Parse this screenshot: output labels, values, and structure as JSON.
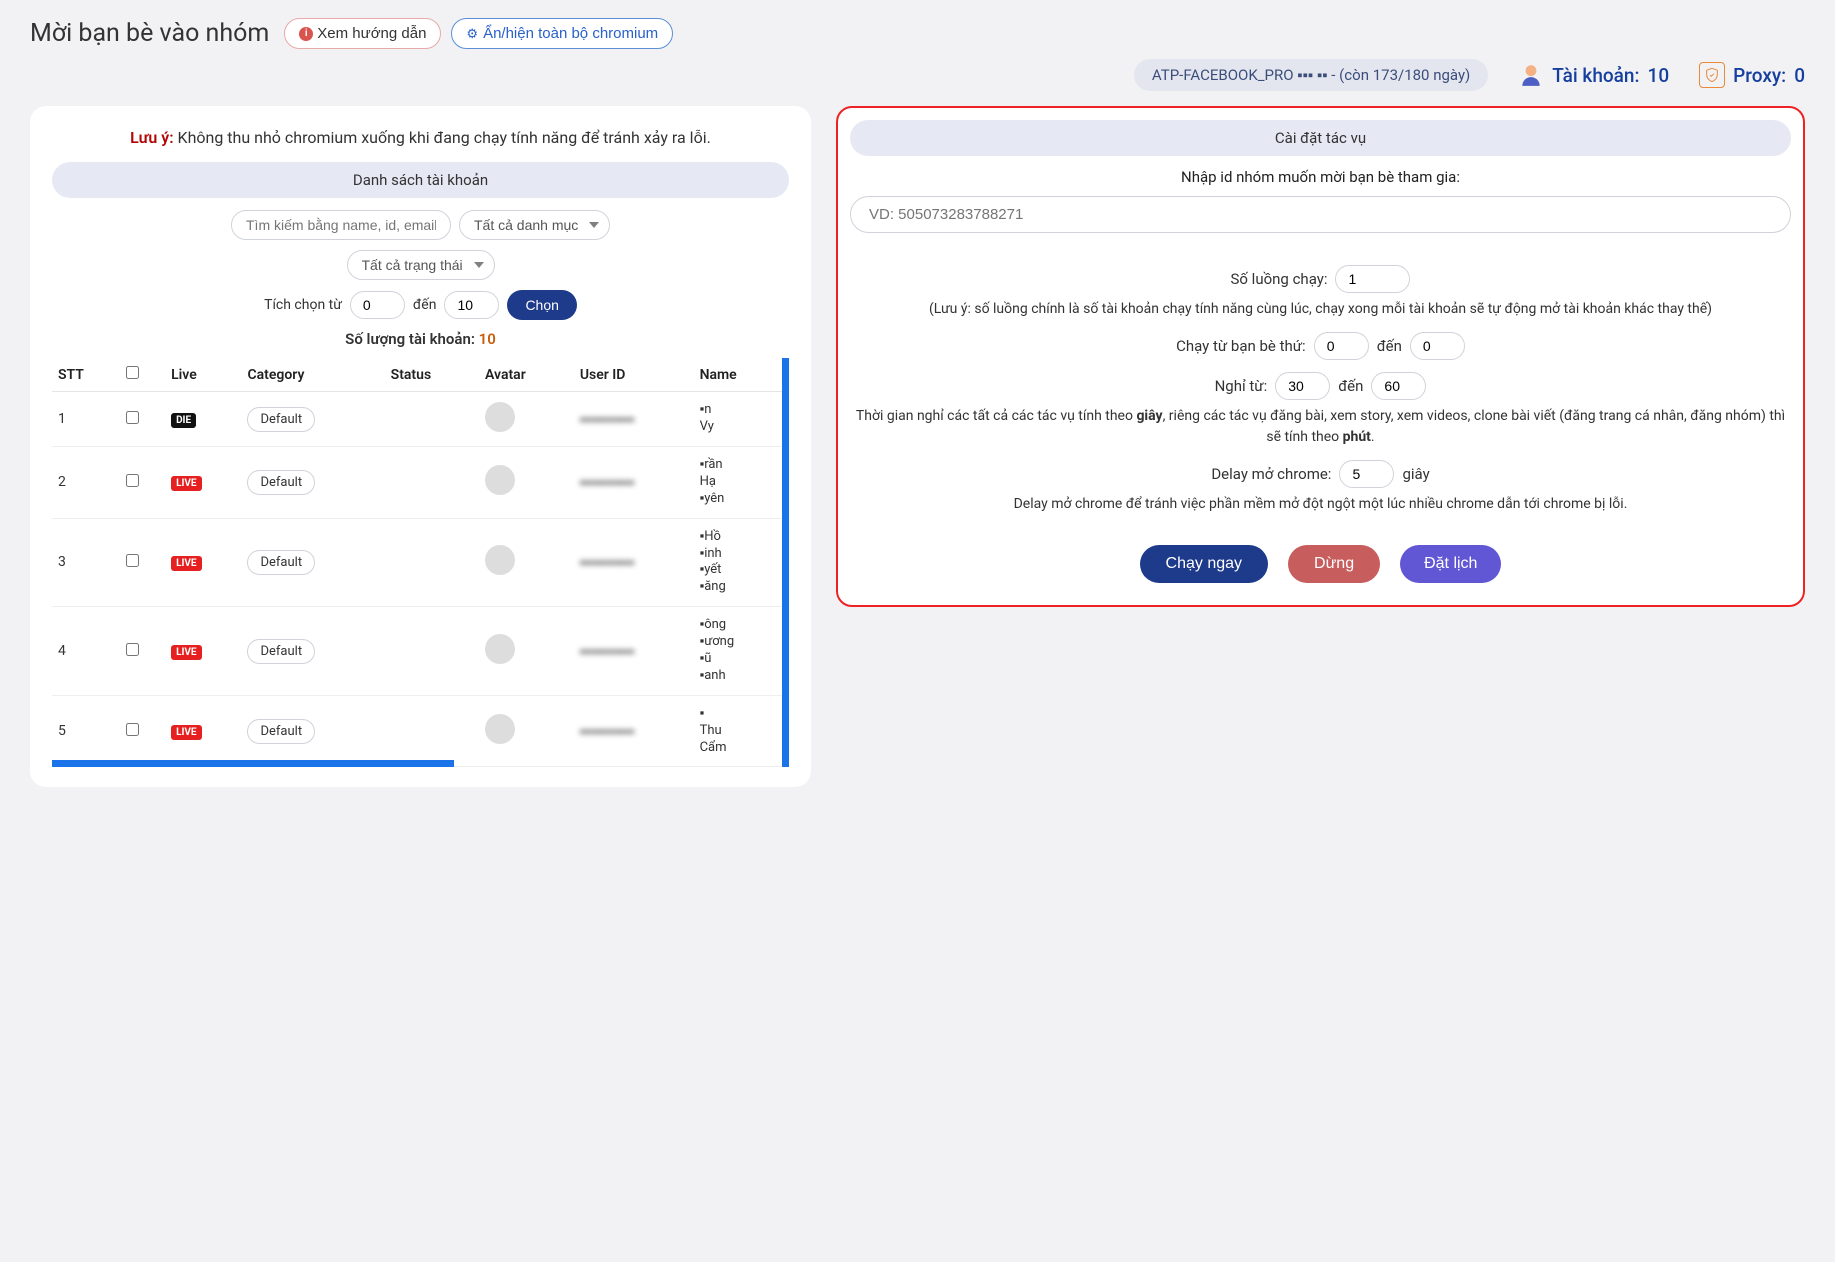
{
  "header": {
    "title": "Mời bạn bè vào nhóm",
    "guide_btn": "Xem hướng dẫn",
    "toggle_chromium_btn": "Ẩn/hiện toàn bộ chromium"
  },
  "info_bar": {
    "license": "ATP-FACEBOOK_PRO ▪▪▪ ▪▪ - (còn 173/180 ngày)",
    "accounts_label": "Tài khoản:",
    "accounts_count": "10",
    "proxy_label": "Proxy:",
    "proxy_count": "0"
  },
  "left_panel": {
    "warning_prefix": "Lưu ý:",
    "warning_text": "Không thu nhỏ chromium xuống khi đang chạy tính năng để tránh xảy ra lỗi.",
    "accounts_header": "Danh sách tài khoản",
    "search_placeholder": "Tìm kiếm bằng name, id, email",
    "category_select": "Tất cả danh mục",
    "status_select": "Tất cả trạng thái",
    "tick_label": "Tích chọn từ",
    "tick_from": "0",
    "tick_to_label": "đến",
    "tick_to": "10",
    "tick_btn": "Chọn",
    "count_label": "Số lượng tài khoản:",
    "count_value": "10",
    "columns": {
      "stt": "STT",
      "checkbox": "",
      "live": "Live",
      "category": "Category",
      "status": "Status",
      "avatar": "Avatar",
      "user_id": "User ID",
      "name": "Name"
    },
    "rows": [
      {
        "stt": "1",
        "live": "DIE",
        "category": "Default",
        "status": "",
        "user_id": "▪▪▪▪▪▪▪▪▪▪▪",
        "name": "▪n Vy"
      },
      {
        "stt": "2",
        "live": "LIVE",
        "category": "Default",
        "status": "",
        "user_id": "▪▪▪▪▪▪▪▪▪▪▪",
        "name": "▪rần Hạ ▪yên"
      },
      {
        "stt": "3",
        "live": "LIVE",
        "category": "Default",
        "status": "",
        "user_id": "▪▪▪▪▪▪▪▪▪▪▪",
        "name": "▪Hồ ▪inh ▪yết ▪ăng"
      },
      {
        "stt": "4",
        "live": "LIVE",
        "category": "Default",
        "status": "",
        "user_id": "▪▪▪▪▪▪▪▪▪▪▪",
        "name": "▪ông ▪ương ▪ũ ▪anh"
      },
      {
        "stt": "5",
        "live": "LIVE",
        "category": "Default",
        "status": "",
        "user_id": "▪▪▪▪▪▪▪▪▪▪▪",
        "name": "▪ Thu Cẩm"
      }
    ]
  },
  "right_panel": {
    "settings_header": "Cài đặt tác vụ",
    "group_id_label": "Nhập id nhóm muốn mời bạn bè tham gia:",
    "group_id_placeholder": "VD: 505073283788271",
    "threads_label": "Số luồng chạy:",
    "threads_value": "1",
    "threads_note": "(Lưu ý: số luồng chính là số tài khoản chạy tính năng cùng lúc, chạy xong mỗi tài khoản sẽ tự động mở tài khoản khác thay thế)",
    "run_from_label": "Chạy từ bạn bè thứ:",
    "run_from_value": "0",
    "run_to_label": "đến",
    "run_to_value": "0",
    "rest_from_label": "Nghỉ từ:",
    "rest_from_value": "30",
    "rest_to_label": "đến",
    "rest_to_value": "60",
    "rest_note_1": "Thời gian nghỉ các tất cả các tác vụ tính theo ",
    "rest_note_bold1": "giây",
    "rest_note_2": ", riêng các tác vụ đăng bài, xem story, xem videos, clone bài viết (đăng trang cá nhân, đăng nhóm) thì sẽ tính theo ",
    "rest_note_bold2": "phút",
    "rest_note_3": ".",
    "delay_label": "Delay mở chrome:",
    "delay_value": "5",
    "delay_unit": "giây",
    "delay_note": "Delay mở chrome để tránh việc phần mềm mở đột ngột một lúc nhiều chrome dẫn tới chrome bị lỗi.",
    "run_btn": "Chạy ngay",
    "stop_btn": "Dừng",
    "schedule_btn": "Đặt lịch"
  }
}
